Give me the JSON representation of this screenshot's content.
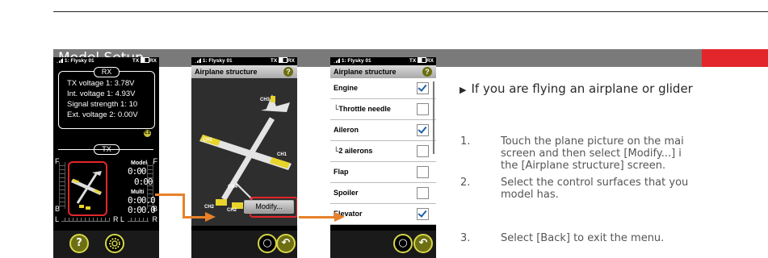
{
  "section_title": "Model Setup",
  "colors": {
    "accent": "#e3262b",
    "arrow": "#e8812a",
    "header_gray": "#7a7a7a"
  },
  "status_bar": {
    "model": "1: Flysky 01",
    "tx": "TX",
    "rx": "RX"
  },
  "screen1": {
    "rx_label": "RX",
    "rx_lines": [
      "TX voltage 1: 3.78V",
      "Int. voltage 1: 4.93V",
      "Signal strength 1: 10",
      "Ext. voltage 2: 0.00V"
    ],
    "tx_label": "TX",
    "side_labels": {
      "f": "F",
      "b": "B",
      "r": "R",
      "l": "L"
    },
    "model_label": "Model",
    "model_time_1": "0:00",
    "model_time_2": "0:00",
    "multi_label": "Multi",
    "multi_time_1": "0:00.0",
    "multi_time_2": "0:00.0",
    "help_icon": "question-icon",
    "settings_icon": "gear-icon"
  },
  "screen2": {
    "title": "Airplane structure",
    "channels": [
      "CH3",
      "CH1",
      "CH1",
      "CH4",
      "CH2",
      "CH2"
    ],
    "modify_label": "Modify..."
  },
  "screen3": {
    "title": "Airplane structure",
    "items": [
      {
        "label": "Engine",
        "checked": true
      },
      {
        "label": "└Throttle needle",
        "checked": false
      },
      {
        "label": "Aileron",
        "checked": true
      },
      {
        "label": "└2 ailerons",
        "checked": false
      },
      {
        "label": "Flap",
        "checked": false
      },
      {
        "label": "Spoiler",
        "checked": false
      },
      {
        "label": "Elevator",
        "checked": true
      }
    ]
  },
  "instructions": {
    "intro": "If you are flying an airplane or glider",
    "steps": [
      {
        "num": "1.",
        "lines": [
          "Touch the plane picture on the mai",
          "screen and then select [Modify...] i",
          "the [Airplane structure] screen."
        ]
      },
      {
        "num": "2.",
        "lines": [
          "Select the control surfaces that you",
          "model has."
        ]
      },
      {
        "num": "3.",
        "lines": [
          "Select [Back]  to exit the menu."
        ]
      }
    ]
  }
}
